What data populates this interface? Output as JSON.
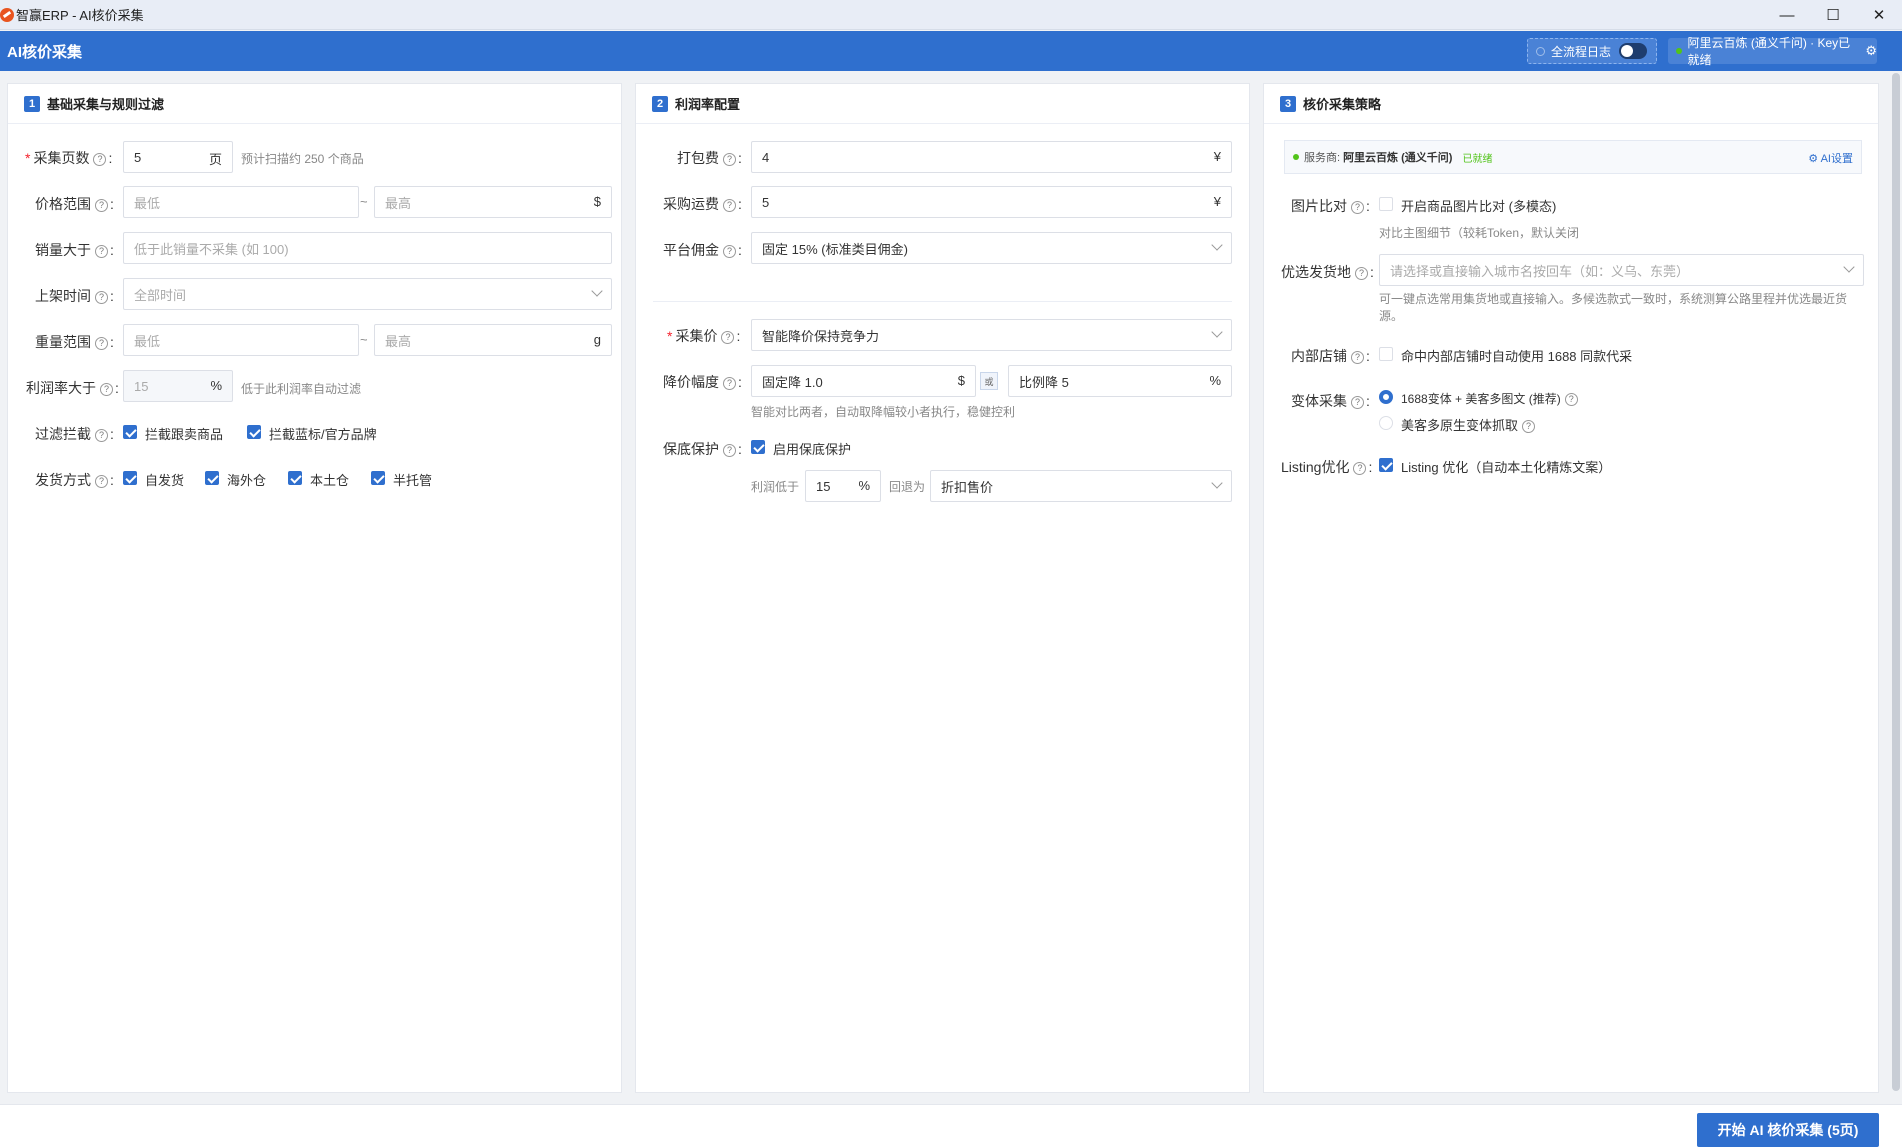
{
  "window": {
    "title": "智赢ERP - AI核价采集",
    "minimize": "—",
    "maximize": "☐",
    "close": "✕"
  },
  "header": {
    "title": "AI核价采集",
    "log_label": "全流程日志",
    "log_enabled": false,
    "ai_status": "阿里云百炼 (通义千问) · Key已就绪",
    "gear": "⚙"
  },
  "help_glyph": "?",
  "colon": ":",
  "tilde": "~",
  "panel1": {
    "num": "1",
    "title": "基础采集与规则过滤",
    "pages": {
      "label": "采集页数",
      "value": "5",
      "unit": "页",
      "hint": "预计扫描约 250 个商品"
    },
    "price": {
      "label": "价格范围",
      "min_placeholder": "最低",
      "max_placeholder": "最高",
      "unit": "$"
    },
    "sales": {
      "label": "销量大于",
      "placeholder": "低于此销量不采集 (如 100)"
    },
    "listed": {
      "label": "上架时间",
      "placeholder": "全部时间"
    },
    "weight": {
      "label": "重量范围",
      "min_placeholder": "最低",
      "max_placeholder": "最高",
      "unit": "g"
    },
    "profit": {
      "label": "利润率大于",
      "placeholder": "15",
      "unit": "%",
      "hint": "低于此利润率自动过滤"
    },
    "filter": {
      "label": "过滤拦截",
      "options": [
        {
          "label": "拦截跟卖商品",
          "checked": true
        },
        {
          "label": "拦截蓝标/官方品牌",
          "checked": true
        }
      ]
    },
    "ship": {
      "label": "发货方式",
      "options": [
        {
          "label": "自发货",
          "checked": true
        },
        {
          "label": "海外仓",
          "checked": true
        },
        {
          "label": "本土仓",
          "checked": true
        },
        {
          "label": "半托管",
          "checked": true
        }
      ]
    }
  },
  "panel2": {
    "num": "2",
    "title": "利润率配置",
    "packing": {
      "label": "打包费",
      "value": "4",
      "unit": "¥"
    },
    "freight": {
      "label": "采购运费",
      "value": "5",
      "unit": "¥"
    },
    "commission": {
      "label": "平台佣金",
      "value": "固定 15% (标准类目佣金)"
    },
    "pricing": {
      "label": "采集价",
      "value": "智能降价保持竞争力"
    },
    "drop": {
      "label": "降价幅度",
      "fixed": "固定降 1.0",
      "fixed_unit": "$",
      "or": "或",
      "ratio": "比例降 5",
      "ratio_unit": "%",
      "hint": "智能对比两者，自动取降幅较小者执行，稳健控利"
    },
    "protect": {
      "label": "保底保护",
      "checkbox_label": "启用保底保护",
      "checked": true,
      "below_label": "利润低于",
      "below_value": "15",
      "below_unit": "%",
      "fallback_label": "回退为",
      "fallback_value": "折扣售价"
    }
  },
  "panel3": {
    "num": "3",
    "title": "核价采集策略",
    "provider": {
      "label": "服务商:",
      "name": "阿里云百炼 (通义千问)",
      "status": "已就绪",
      "settings": "AI设置"
    },
    "image_compare": {
      "label": "图片比对",
      "checkbox_label": "开启商品图片比对 (多模态)",
      "checked": false,
      "hint": "对比主图细节（较耗Token，默认关闭"
    },
    "origin": {
      "label": "优选发货地",
      "placeholder": "请选择或直接输入城市名按回车（如：义乌、东莞）",
      "hint_line1": "可一键点选常用集货地或直接输入。多候选款式一致时，系统测算公路里程并优选最近货",
      "hint_line2": "源。"
    },
    "internal": {
      "label": "内部店铺",
      "checkbox_label": "命中内部店铺时自动使用 1688 同款代采",
      "checked": false
    },
    "variant": {
      "label": "变体采集",
      "options": [
        {
          "label": "1688变体 + 美客多图文 (推荐)",
          "selected": true
        },
        {
          "label": "美客多原生变体抓取",
          "selected": false
        }
      ]
    },
    "listing": {
      "label": "Listing优化",
      "checkbox_label": "Listing 优化（自动本土化精炼文案）",
      "checked": true
    }
  },
  "footer": {
    "start_button": "开始 AI 核价采集 (5页)"
  }
}
